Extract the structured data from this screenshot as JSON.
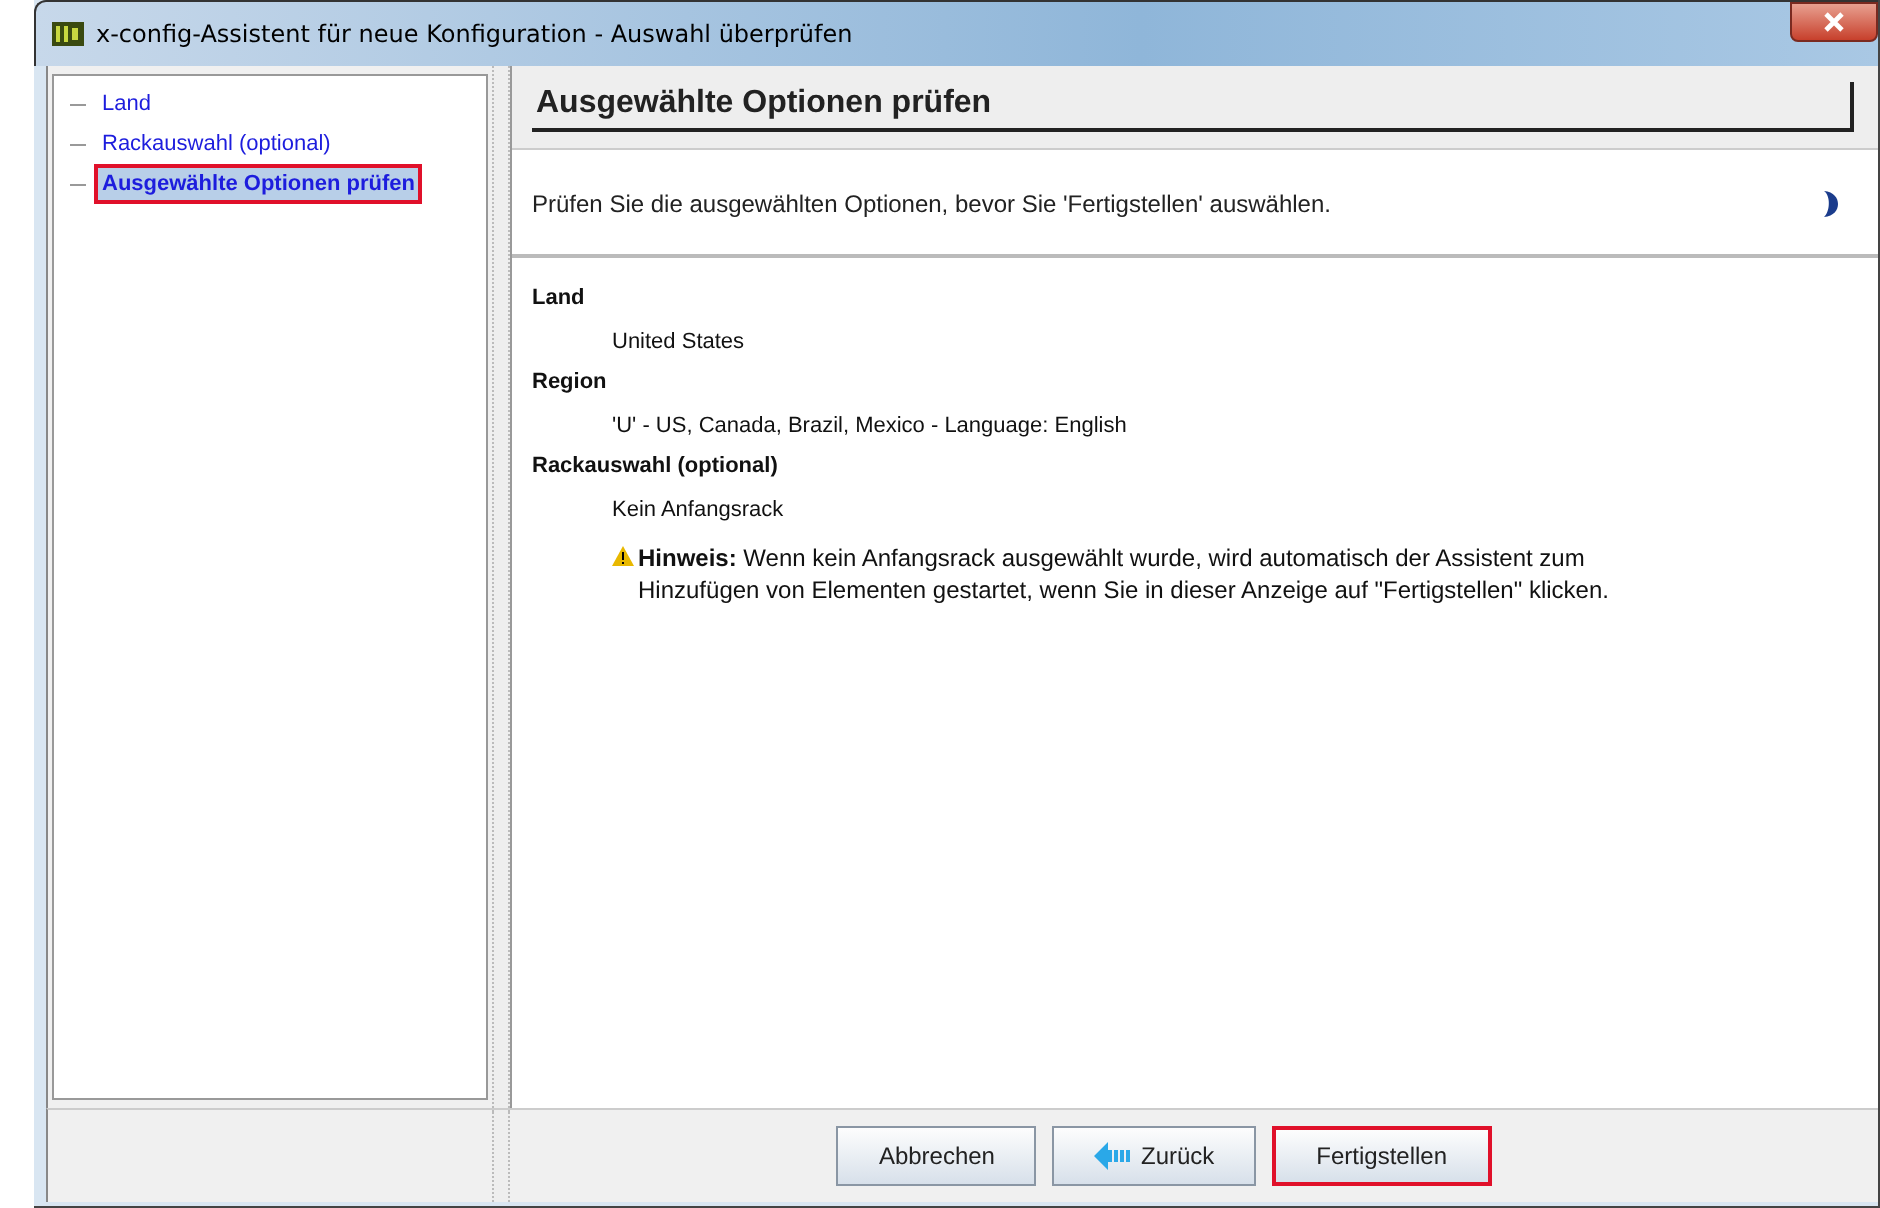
{
  "window": {
    "title": "x-config-Assistent für neue Konfiguration - Auswahl überprüfen"
  },
  "steps": [
    {
      "label": "Land",
      "selected": false,
      "highlighted": false
    },
    {
      "label": "Rackauswahl (optional)",
      "selected": false,
      "highlighted": false
    },
    {
      "label": "Ausgewählte Optionen prüfen",
      "selected": true,
      "highlighted": true
    }
  ],
  "page": {
    "heading": "Ausgewählte Optionen prüfen",
    "instruction": "Prüfen Sie die ausgewählten Optionen, bevor Sie 'Fertigstellen' auswählen."
  },
  "summary": [
    {
      "kind": "heading",
      "text": "Land"
    },
    {
      "kind": "value",
      "text": "United States"
    },
    {
      "kind": "heading",
      "text": "Region"
    },
    {
      "kind": "value",
      "text": "'U' - US, Canada, Brazil, Mexico - Language: English"
    },
    {
      "kind": "heading",
      "text": "Rackauswahl (optional)"
    },
    {
      "kind": "value",
      "text": "Kein Anfangsrack"
    }
  ],
  "note": "**Hinweis:** Wenn kein Anfangsrack ausgewählt wurde, wird automatisch der Assistent zum Hinzufügen von Elementen gestartet, wenn Sie in dieser Anzeige auf \"Fertigstellen\" klicken.",
  "buttons": [
    {
      "label": "Abbrechen",
      "kind": "plain",
      "highlighted": false
    },
    {
      "label": "Zurück",
      "kind": "back",
      "highlighted": false
    },
    {
      "label": "Fertigstellen",
      "kind": "plain",
      "highlighted": true
    }
  ]
}
